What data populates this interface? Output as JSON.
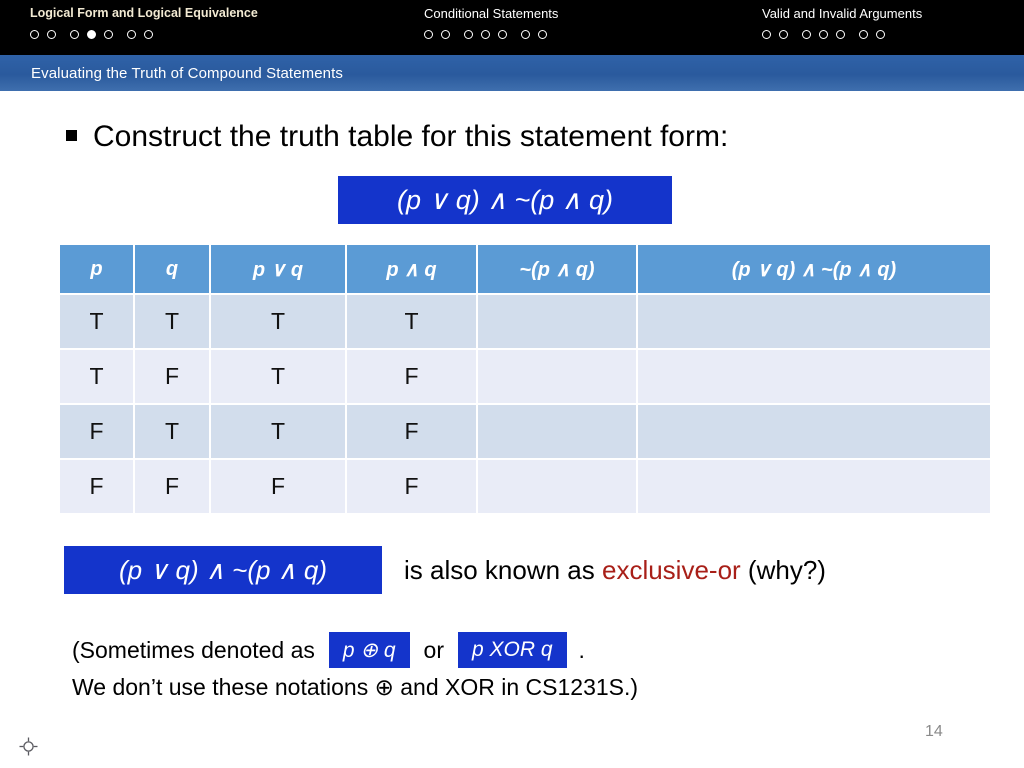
{
  "topbar": {
    "groups": [
      {
        "title": "Logical Form and Logical Equivalence",
        "dots": 7,
        "active_index": 3
      },
      {
        "title": "Conditional Statements",
        "dots": 7,
        "active_index": -1
      },
      {
        "title": "Valid and Invalid Arguments",
        "dots": 7,
        "active_index": -1
      }
    ]
  },
  "banner": {
    "title": "Evaluating the Truth of Compound Statements"
  },
  "content": {
    "bullet_text": "Construct the truth table for this statement form:",
    "main_formula": "(p ∨ q) ∧ ~(p ∧ q)"
  },
  "truth_table": {
    "headers": [
      "p",
      "q",
      "p ∨ q",
      "p ∧ q",
      "~(p ∧ q)",
      "(p ∨ q) ∧ ~(p ∧ q)"
    ],
    "rows": [
      {
        "p": "T",
        "q": "T",
        "p_or_q": "T",
        "p_and_q": "T",
        "not_p_and_q": "",
        "result": ""
      },
      {
        "p": "T",
        "q": "F",
        "p_or_q": "T",
        "p_and_q": "F",
        "not_p_and_q": "",
        "result": ""
      },
      {
        "p": "F",
        "q": "T",
        "p_or_q": "T",
        "p_and_q": "F",
        "not_p_and_q": "",
        "result": ""
      },
      {
        "p": "F",
        "q": "F",
        "p_or_q": "F",
        "p_and_q": "F",
        "not_p_and_q": "",
        "result": ""
      }
    ]
  },
  "xor_section": {
    "formula": "(p ∨ q) ∧ ~(p ∧ q)",
    "text_before": "is also known as ",
    "highlight": "exclusive-or",
    "text_after": " (why?)"
  },
  "note": {
    "line1_prefix": "(Sometimes denoted as",
    "box1": "p ⊕ q",
    "or": "or",
    "box2": "p XOR q",
    "period": ".",
    "line2": "We don’t use these notations ⊕ and XOR in CS1231S.)"
  },
  "footer": {
    "page_number": "14"
  },
  "colors": {
    "banner_blue": "#2E5FA3",
    "header_blue": "#5B9BD5",
    "formula_blue": "#1434CB",
    "row_odd": "#D2DDEC",
    "row_even": "#E9ECF7",
    "true_blue": "#1F5FD0",
    "false_green": "#4C7A2E",
    "exclusive_red": "#A81F18"
  }
}
